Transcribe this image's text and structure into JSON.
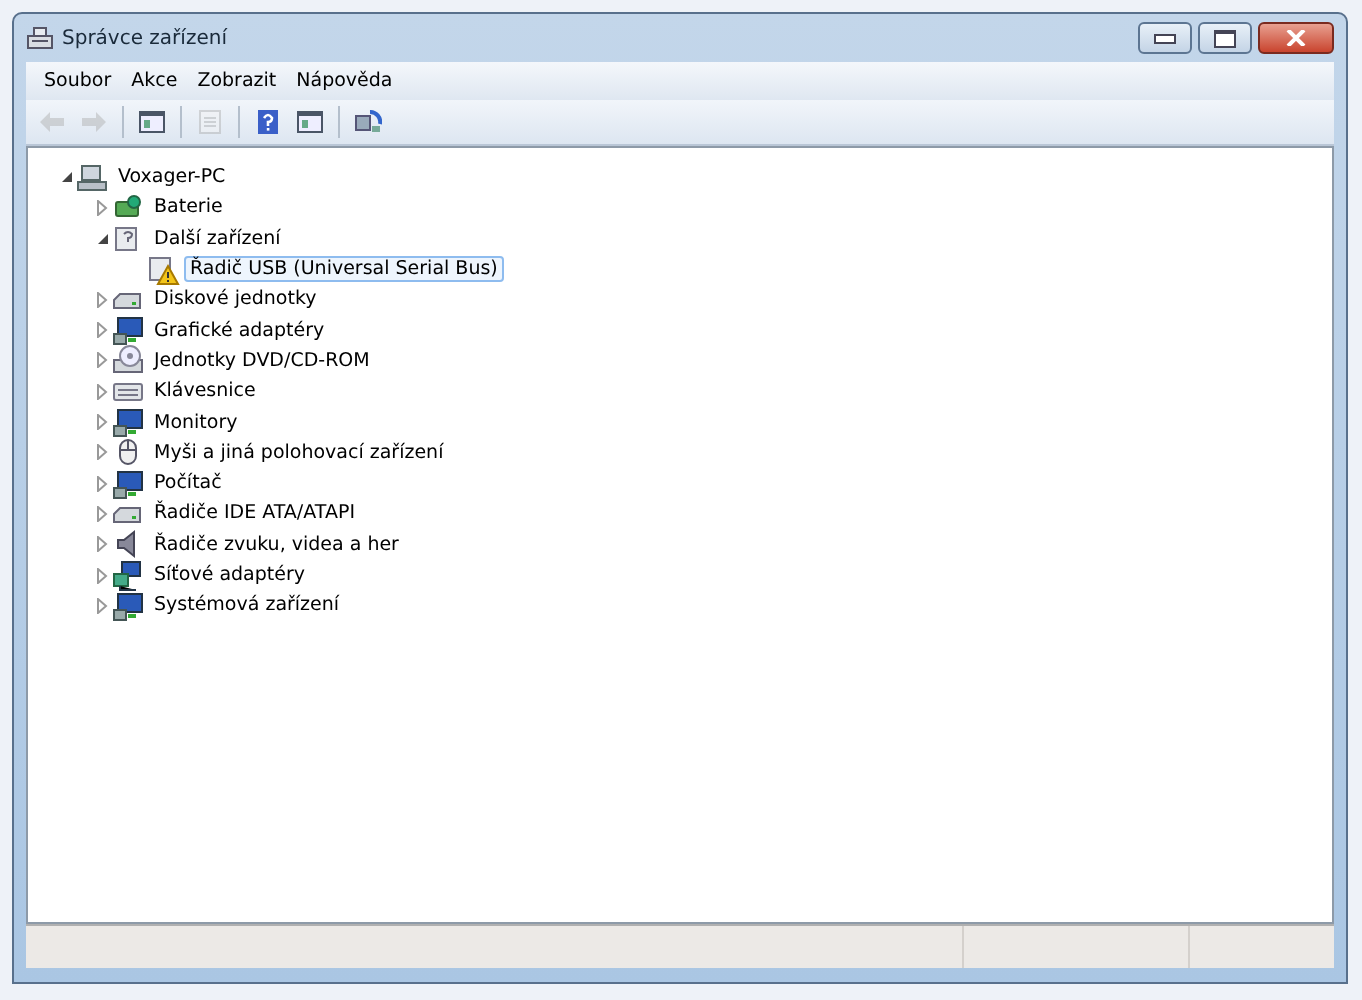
{
  "window": {
    "title": "Správce zařízení"
  },
  "menu": [
    "Soubor",
    "Akce",
    "Zobrazit",
    "Nápověda"
  ],
  "toolbar": [
    {
      "kind": "back",
      "disabled": true
    },
    {
      "kind": "forward",
      "disabled": true
    },
    {
      "kind": "sep"
    },
    {
      "kind": "panel",
      "disabled": false
    },
    {
      "kind": "sep"
    },
    {
      "kind": "page",
      "disabled": true
    },
    {
      "kind": "sep"
    },
    {
      "kind": "help",
      "disabled": false
    },
    {
      "kind": "panel",
      "disabled": false
    },
    {
      "kind": "sep"
    },
    {
      "kind": "scan",
      "disabled": false
    }
  ],
  "tree": [
    {
      "label": "Voxager-PC",
      "kind": "computer",
      "expanded": true,
      "selected": false,
      "children": [
        {
          "label": "Baterie",
          "kind": "battery",
          "expanded": false,
          "selected": false
        },
        {
          "label": "Další zařízení",
          "kind": "other",
          "expanded": true,
          "selected": false,
          "children": [
            {
              "label": "Řadič USB (Universal Serial Bus)",
              "kind": "warning",
              "selected": true
            }
          ]
        },
        {
          "label": "Diskové jednotky",
          "kind": "disk",
          "expanded": false,
          "selected": false
        },
        {
          "label": "Grafické adaptéry",
          "kind": "display",
          "expanded": false,
          "selected": false
        },
        {
          "label": "Jednotky DVD/CD-ROM",
          "kind": "dvd",
          "expanded": false,
          "selected": false
        },
        {
          "label": "Klávesnice",
          "kind": "keyboard",
          "expanded": false,
          "selected": false
        },
        {
          "label": "Monitory",
          "kind": "display",
          "expanded": false,
          "selected": false
        },
        {
          "label": "Myši a jiná polohovací zařízení",
          "kind": "mouse",
          "expanded": false,
          "selected": false
        },
        {
          "label": "Počítač",
          "kind": "display",
          "expanded": false,
          "selected": false
        },
        {
          "label": "Řadiče IDE ATA/ATAPI",
          "kind": "disk",
          "expanded": false,
          "selected": false
        },
        {
          "label": "Řadiče zvuku, videa a her",
          "kind": "speaker",
          "expanded": false,
          "selected": false
        },
        {
          "label": "Síťové adaptéry",
          "kind": "network",
          "expanded": false,
          "selected": false
        },
        {
          "label": "Systémová zařízení",
          "kind": "display",
          "expanded": false,
          "selected": false
        }
      ]
    }
  ]
}
